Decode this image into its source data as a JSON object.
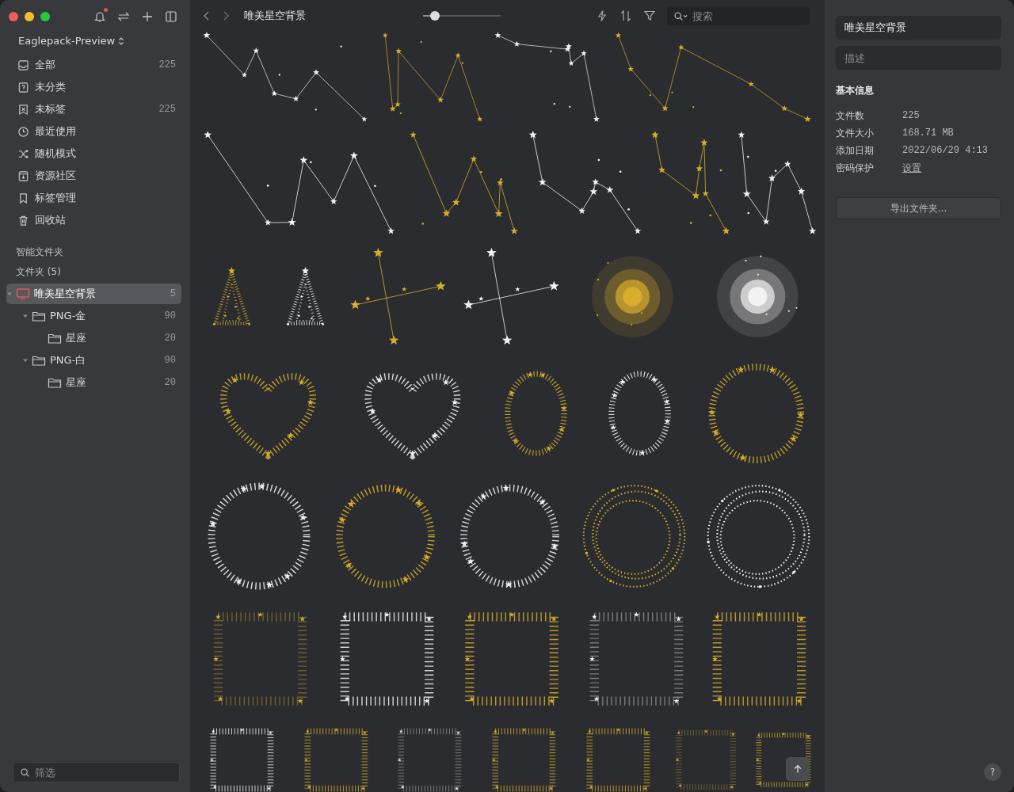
{
  "sidebar": {
    "library": "Eaglepack-Preview",
    "nav": [
      {
        "label": "全部",
        "count": "225"
      },
      {
        "label": "未分类"
      },
      {
        "label": "未标签",
        "count": "225"
      },
      {
        "label": "最近使用"
      },
      {
        "label": "随机模式"
      },
      {
        "label": "资源社区"
      },
      {
        "label": "标签管理"
      },
      {
        "label": "回收站"
      }
    ],
    "smart_folders_label": "智能文件夹",
    "folders_label": "文件夹 (5)",
    "folders": [
      {
        "name": "唯美星空背景",
        "count": "5",
        "selected": true,
        "expanded": true,
        "children": [
          {
            "name": "PNG-金",
            "count": "90",
            "selected": false,
            "expanded": true,
            "children": [
              {
                "name": "星座",
                "count": "20",
                "selected": false
              }
            ]
          },
          {
            "name": "PNG-白",
            "count": "90",
            "selected": false,
            "expanded": true,
            "children": [
              {
                "name": "星座",
                "count": "20",
                "selected": false
              }
            ]
          }
        ]
      }
    ],
    "filter": {
      "placeholder": "筛选"
    },
    "notification_unread": true
  },
  "toolbar": {
    "title": "唯美星空背景",
    "zoom": {
      "level": 0.15
    },
    "search": {
      "placeholder": "搜索"
    }
  },
  "inspector": {
    "name": "唯美星空背景",
    "description": {
      "placeholder": "描述"
    },
    "section": "基本信息",
    "info": [
      {
        "label": "文件数",
        "value": "225",
        "kind": "text"
      },
      {
        "label": "文件大小",
        "value": "168.71 MB",
        "kind": "text"
      },
      {
        "label": "添加日期",
        "value": "2022/06/29 4:13",
        "kind": "text"
      },
      {
        "label": "密码保护",
        "value": "设置",
        "kind": "link"
      }
    ],
    "export_button": "导出文件夹...",
    "help": "?"
  }
}
